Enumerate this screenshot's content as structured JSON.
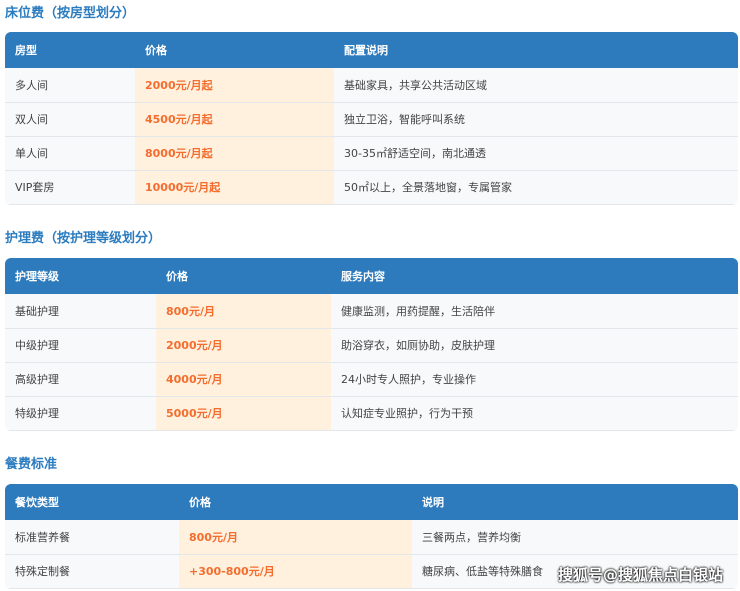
{
  "sections": [
    {
      "title": "床位费（按房型划分）",
      "headers": [
        "房型",
        "价格",
        "配置说明"
      ],
      "rows": [
        [
          "多人间",
          "2000元/月起",
          "基础家具，共享公共活动区域"
        ],
        [
          "双人间",
          "4500元/月起",
          "独立卫浴，智能呼叫系统"
        ],
        [
          "单人间",
          "8000元/月起",
          "30-35㎡舒适空间，南北通透"
        ],
        [
          "VIP套房",
          "10000元/月起",
          "50㎡以上，全景落地窗，专属管家"
        ]
      ]
    },
    {
      "title": "护理费（按护理等级划分）",
      "headers": [
        "护理等级",
        "价格",
        "服务内容"
      ],
      "rows": [
        [
          "基础护理",
          "800元/月",
          "健康监测，用药提醒，生活陪伴"
        ],
        [
          "中级护理",
          "2000元/月",
          "助浴穿衣，如厕协助，皮肤护理"
        ],
        [
          "高级护理",
          "4000元/月",
          "24小时专人照护，专业操作"
        ],
        [
          "特级护理",
          "5000元/月",
          "认知症专业照护，行为干预"
        ]
      ]
    },
    {
      "title": "餐费标准",
      "headers": [
        "餐饮类型",
        "价格",
        "说明"
      ],
      "rows": [
        [
          "标准营养餐",
          "800元/月",
          "三餐两点，营养均衡"
        ],
        [
          "特殊定制餐",
          "+300-800元/月",
          "糖尿病、低盐等特殊膳食"
        ]
      ]
    }
  ],
  "watermark": "搜狐号@搜狐焦点白银站"
}
